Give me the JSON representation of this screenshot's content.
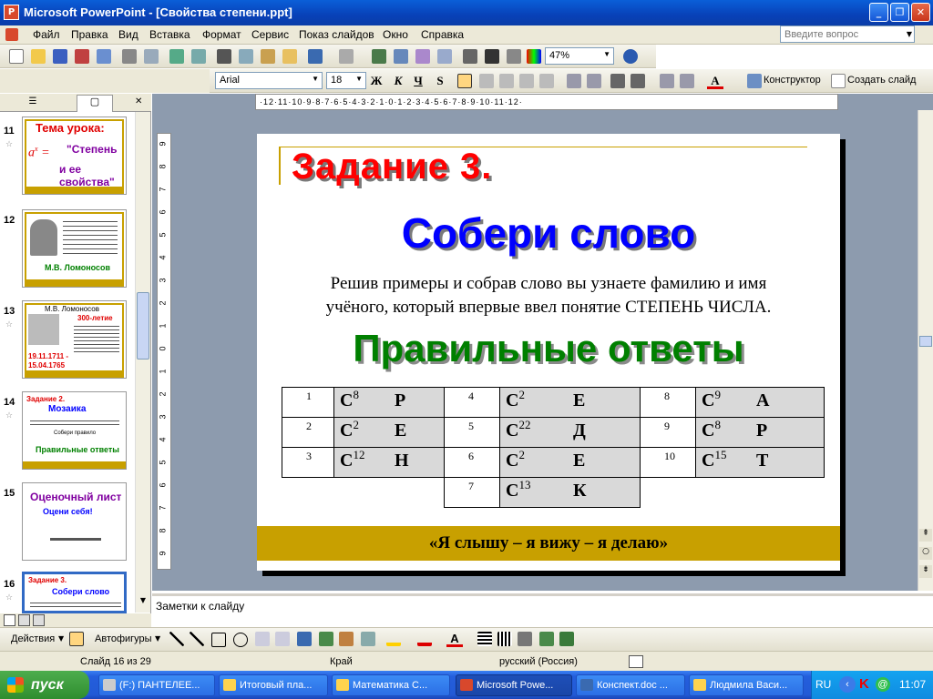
{
  "window": {
    "title": "Microsoft PowerPoint - [Свойства степени.ppt]",
    "min": "_",
    "max": "❐",
    "close": "✕"
  },
  "menu": {
    "items": [
      "Файл",
      "Правка",
      "Вид",
      "Вставка",
      "Формат",
      "Сервис",
      "Показ слайдов",
      "Окно",
      "Справка"
    ],
    "help_placeholder": "Введите вопрос"
  },
  "toolbar": {
    "zoom": "47%",
    "font": "Arial",
    "size": "18",
    "bold": "Ж",
    "italic": "К",
    "underline": "Ч",
    "shadow": "S",
    "designer": "Конструктор",
    "new_slide": "Создать слайд"
  },
  "ruler": {
    "h": "·12·11·10·9·8·7·6·5·4·3·2·1·0·1·2·3·4·5·6·7·8·9·10·11·12·",
    "v": [
      "9",
      "8",
      "7",
      "6",
      "5",
      "4",
      "3",
      "2",
      "1",
      "0",
      "1",
      "2",
      "3",
      "4",
      "5",
      "6",
      "7",
      "8",
      "9"
    ]
  },
  "thumbnails": [
    {
      "num": "11",
      "title": "Тема урока:",
      "l1": "\"Степень",
      "l2": "и ее свойства\""
    },
    {
      "num": "12",
      "caption": "М.В. Ломоносов"
    },
    {
      "num": "13",
      "title": "М.В. Ломоносов",
      "sub": "300-летие",
      "d1": "19.11.1711 -",
      "d2": "15.04.1765"
    },
    {
      "num": "14",
      "title": "Задание 2.",
      "sub": "Мозаика",
      "mid": "Собери правило",
      "foot": "Правильные ответы"
    },
    {
      "num": "15",
      "title": "Оценочный лист",
      "sub": "Оцени себя!"
    },
    {
      "num": "16",
      "title": "Задание 3.",
      "sub": "Собери слово"
    }
  ],
  "slide": {
    "title": "Задание 3.",
    "subtitle": "Собери слово",
    "body_l1": "Решив примеры и собрав слово вы узнаете фамилию и имя",
    "body_l2": "учёного, который впервые ввел понятие СТЕПЕНЬ ЧИСЛА.",
    "answers_title": "Правильные ответы",
    "table": [
      [
        {
          "n": "1",
          "b": "С",
          "e": "8",
          "l": "Р"
        },
        {
          "n": "4",
          "b": "С",
          "e": "2",
          "l": "Е"
        },
        {
          "n": "8",
          "b": "С",
          "e": "9",
          "l": "А"
        }
      ],
      [
        {
          "n": "2",
          "b": "С",
          "e": "2",
          "l": "Е"
        },
        {
          "n": "5",
          "b": "С",
          "e": "22",
          "l": "Д"
        },
        {
          "n": "9",
          "b": "С",
          "e": "8",
          "l": "Р"
        }
      ],
      [
        {
          "n": "3",
          "b": "С",
          "e": "12",
          "l": "Н"
        },
        {
          "n": "6",
          "b": "С",
          "e": "2",
          "l": "Е"
        },
        {
          "n": "10",
          "b": "С",
          "e": "15",
          "l": "Т"
        }
      ],
      [
        {
          "n": "7",
          "b": "С",
          "e": "13",
          "l": "К"
        }
      ]
    ],
    "footer": "«Я слышу – я вижу – я делаю»"
  },
  "notes": "Заметки к слайду",
  "drawbar": {
    "actions": "Действия",
    "autoshapes": "Автофигуры"
  },
  "status": {
    "slide": "Слайд 16 из 29",
    "design": "Край",
    "lang": "русский (Россия)"
  },
  "taskbar": {
    "start": "пуск",
    "items": [
      "(F:) ПАНТЕЛЕЕ...",
      "Итоговый пла...",
      "Математика С...",
      "Microsoft Powe...",
      "Конспект.doc ...",
      "Людмила Васи..."
    ],
    "lang": "RU",
    "clock": "11:07"
  },
  "colors": {
    "title_red": "#ff0000",
    "subtitle_blue": "#0000ff",
    "answers_green": "#008000",
    "footer_gold": "#c8a000"
  }
}
